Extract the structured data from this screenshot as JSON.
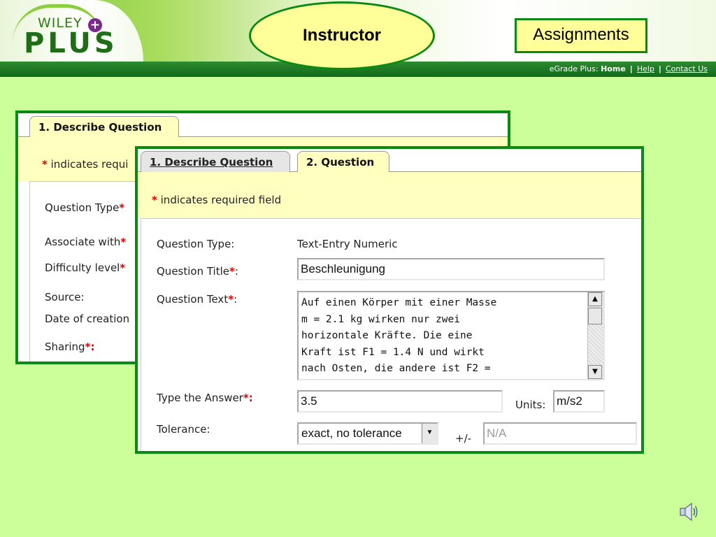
{
  "header": {
    "logo_top": "WILEY",
    "logo_plus_sign": "+",
    "logo_bottom": "PLUS",
    "instructor_label": "Instructor",
    "assignments_label": "Assignments",
    "nav": {
      "product_prefix": "eGrade Plus:",
      "home": "Home",
      "separator": "|",
      "help": "Help",
      "contact": "Contact Us"
    }
  },
  "back_panel": {
    "tab_label": "1. Describe Question",
    "required_note_prefix": "*",
    "required_note": "indicates requi",
    "fields": [
      {
        "label": "Question Type",
        "star": "*"
      },
      {
        "label": "Associate with",
        "star": "*"
      },
      {
        "label": "Difficulty level",
        "star": "*"
      },
      {
        "label": "Source:",
        "star": ""
      },
      {
        "label": "Date of creation",
        "star": ""
      },
      {
        "label": "Sharing",
        "star": "*:"
      }
    ]
  },
  "front_panel": {
    "tabs": [
      {
        "label": "1. Describe Question",
        "active": false
      },
      {
        "label": "2. Question",
        "active": true
      }
    ],
    "required_star": "*",
    "required_note": "indicates required field",
    "question_type_label": "Question Type:",
    "question_type_value": "Text-Entry Numeric",
    "question_title_label": "Question Title",
    "question_title_value": "Beschleunigung",
    "question_text_label": "Question Text",
    "question_text_value": "Auf einen Körper mit einer Masse\nm = 2.1 kg wirken nur zwei\nhorizontale Kräfte. Die eine\nKraft ist F1 = 1.4 N und wirkt\nnach Osten, die andere ist F2 =",
    "answer_label": "Type the Answer",
    "answer_value": "3.5",
    "units_label": "Units:",
    "units_value": "m/s2",
    "tolerance_label": "Tolerance:",
    "tolerance_selected": "exact, no tolerance",
    "plusminus_label": "+/-",
    "tolerance_value_placeholder": "N/A",
    "star_colon": "*:"
  },
  "colors": {
    "background": "#ccff99",
    "frame_green": "#0a8a12",
    "highlight_yellow": "#ffff99",
    "required_red": "#e00000"
  },
  "icons": {
    "sound": "speaker-icon",
    "scroll_up": "arrow-up-icon",
    "scroll_down": "arrow-down-icon",
    "dropdown": "chevron-down-icon"
  }
}
